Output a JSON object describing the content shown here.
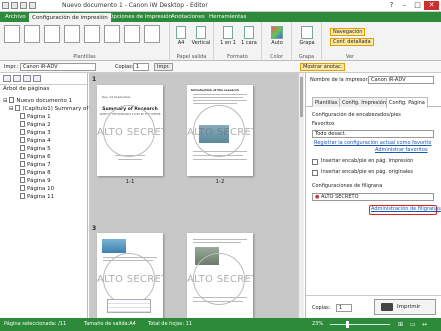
{
  "window": {
    "title": "Nuevo documento 1 - Canon iW Desktop - Editor"
  },
  "ribbon_tabs": [
    "Archivo",
    "Configuración de impresión",
    "Opciones de impresión",
    "Anotaciones",
    "Herramientas"
  ],
  "ribbon": {
    "plantillas_label": "Plantillas",
    "papel_label": "Papel salida",
    "paper_size": "A4",
    "orientation": "Vertical",
    "formato_label": "Formato",
    "pages_per_sheet": "1 en 1",
    "sides": "1 cara",
    "color_label": "Color",
    "color_value": "Auto",
    "grapa_label": "Grapa",
    "grapa_value": "Grapa",
    "ver_label": "Ver",
    "navegacion": "Navegación",
    "conf_detallada": "Conf. detallada"
  },
  "toolbar": {
    "impr_label": "Impr.:",
    "printer": "Canon iR-ADV",
    "copias_label": "Copias:",
    "copies": "1",
    "impr_btn": "Impr.",
    "mostrar_anotac": "Mostrar anotac."
  },
  "tree": {
    "title": "Árbol de páginas",
    "items": [
      "Nuevo documento 1",
      "(Capítulo1) Summary of F",
      "Página 1",
      "Página 2",
      "Página 3",
      "Página 4",
      "Página 5",
      "Página 6",
      "Página 7",
      "Página 8",
      "Página 9",
      "Página 10",
      "Página 11"
    ]
  },
  "pages": {
    "watermark": "ALTO SECRETO",
    "p1_num": "1",
    "p1_caption": "1-1",
    "p2_caption": "1-2",
    "p3_num": "3",
    "p1_heading": "Summary of Research",
    "p1_subheading": "SOME OF THE RESEARCH STUDY BY THE CENTER",
    "p2_heading": "Introduction of the research"
  },
  "right_panel": {
    "printer_label": "Nombre de la impresora:",
    "printer_name": "Canon iR-ADV",
    "tabs": [
      "Plantillas",
      "Config. Impresión",
      "Config. Página"
    ],
    "section_title": "Configuración de encabezados/pies",
    "favoritos_label": "Favoritos",
    "favoritos_value": "Todo desact.",
    "link_register": "Registrar la configuración actual como favorito",
    "link_admin_fav": "Administrar favoritos",
    "check1": "Insertar encab/pie en pág. impresión",
    "check2": "Insertar encab/pie en pág. originales",
    "watermark_section": "Configuraciones de filigrana",
    "watermark_value": "ALTO SECRETO",
    "link_admin_wm": "Administración de filigranas",
    "copias_label": "Copias:",
    "copies": "1",
    "imprimir": "Imprimir"
  },
  "statusbar": {
    "selected": "Página seleccionada: /11",
    "size": "Tamaño de salida:A4",
    "total": "Total de hojas: 11",
    "zoom": "23%"
  },
  "colors": {
    "accent": "#2c8a3a",
    "highlight": "#e02020"
  }
}
